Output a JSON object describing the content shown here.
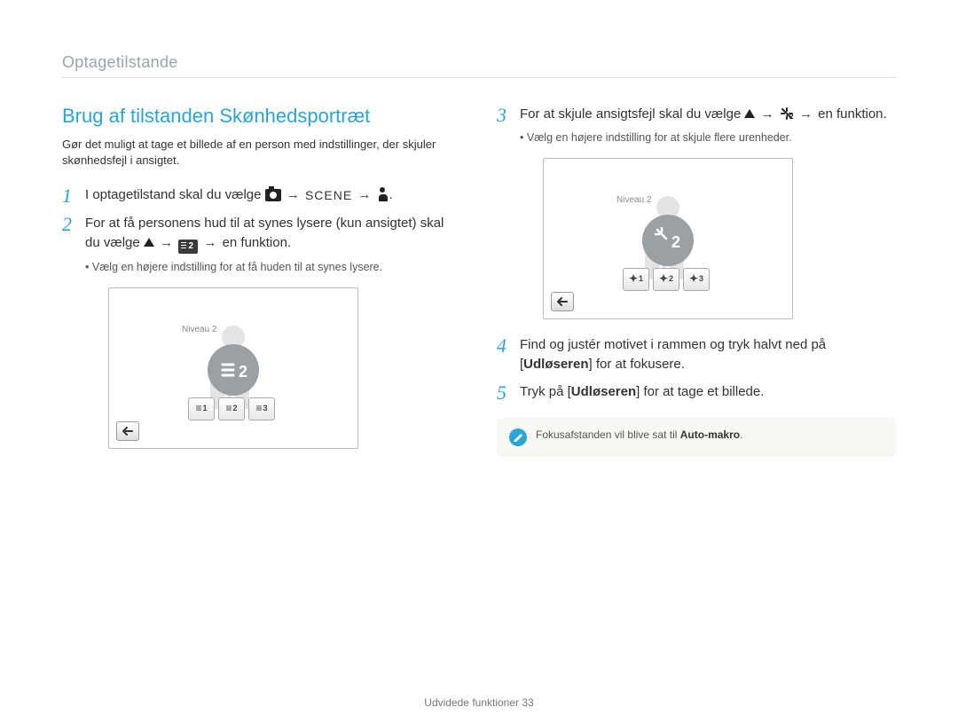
{
  "breadcrumb": "Optagetilstande",
  "left": {
    "title": "Brug af tilstanden Skønhedsportræt",
    "lead": "Gør det muligt at tage et billede af en person med indstillinger, der skjuler skønhedsfejl i ansigtet.",
    "step1_pre": "I optagetilstand skal du vælge ",
    "scene_label": "SCENE",
    "step2_line1": "For at få personens hud til at synes lysere (kun ansigtet) skal du vælge ",
    "step2_tail": " en funktion.",
    "step2_sub": "Vælg en højere indstilling for at få huden til at synes lysere.",
    "screen_badge": "Niveau 2",
    "circle_num": "2",
    "opts": [
      "1",
      "2",
      "3"
    ]
  },
  "right": {
    "step3_pre": "For at skjule ansigtsfejl skal du vælge ",
    "step3_tail": " en funktion.",
    "step3_sub": "Vælg en højere indstilling for at skjule flere urenheder.",
    "screen_badge": "Niveau 2",
    "circle_num": "2",
    "opts": [
      "1",
      "2",
      "3"
    ],
    "step4_pre": "Find og justér motivet i rammen og tryk halvt ned på [",
    "step4_bold": "Udløseren",
    "step4_post": "] for at fokusere.",
    "step5_pre": "Tryk på [",
    "step5_bold": "Udløseren",
    "step5_post": "] for at tage et billede.",
    "note_pre": "Fokusafstanden vil blive sat til ",
    "note_bold": "Auto-makro",
    "note_post": "."
  },
  "footer": {
    "label": "Udvidede funktioner",
    "page": "33"
  }
}
